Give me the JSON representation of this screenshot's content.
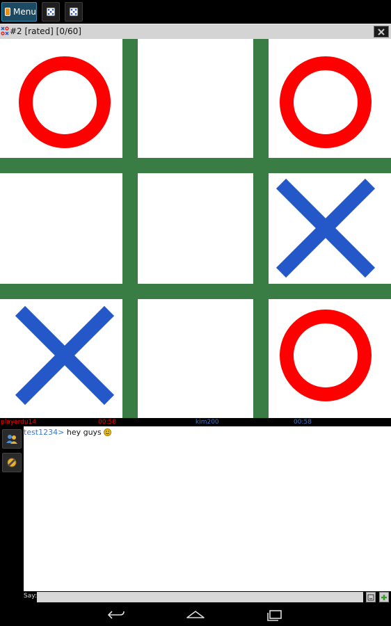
{
  "toolbar": {
    "menu_label": "Menu",
    "icons": [
      "app-menu-icon",
      "dice-icon",
      "dice-icon"
    ]
  },
  "window": {
    "title": "#2 [rated] [0/60]",
    "close_icon": "close-icon"
  },
  "board": {
    "cells": [
      "O",
      "",
      "O",
      "",
      "",
      "X",
      "X",
      "",
      "O"
    ],
    "colors": {
      "grid": "#3a7d44",
      "o": "#ff0000",
      "x": "#2457c8",
      "background": "#ffffff"
    }
  },
  "players": {
    "player1": {
      "name": "playerdu14",
      "time": "00:58",
      "color": "#ff0000"
    },
    "player2": {
      "name": "kim200",
      "time": "00:58",
      "color": "#3a78c9"
    }
  },
  "chat": {
    "messages": [
      {
        "user": "test1234>",
        "text": "hey guys",
        "emoji": "smiley-icon"
      }
    ],
    "say_label": "Say:",
    "say_value": ""
  },
  "sidebar": {
    "buttons": [
      "users-icon",
      "settings-icon"
    ]
  },
  "navigation": {
    "buttons": [
      "back-icon",
      "home-icon",
      "recent-apps-icon"
    ]
  }
}
